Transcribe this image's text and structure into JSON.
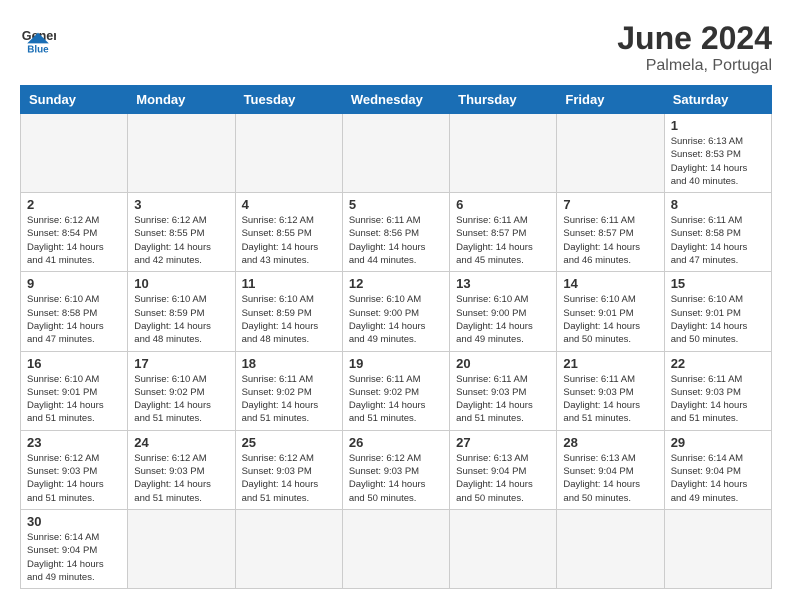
{
  "header": {
    "logo_general": "General",
    "logo_blue": "Blue",
    "month_year": "June 2024",
    "location": "Palmela, Portugal"
  },
  "days_of_week": [
    "Sunday",
    "Monday",
    "Tuesday",
    "Wednesday",
    "Thursday",
    "Friday",
    "Saturday"
  ],
  "weeks": [
    [
      {
        "day": "",
        "info": ""
      },
      {
        "day": "",
        "info": ""
      },
      {
        "day": "",
        "info": ""
      },
      {
        "day": "",
        "info": ""
      },
      {
        "day": "",
        "info": ""
      },
      {
        "day": "",
        "info": ""
      },
      {
        "day": "1",
        "info": "Sunrise: 6:13 AM\nSunset: 8:53 PM\nDaylight: 14 hours\nand 40 minutes."
      }
    ],
    [
      {
        "day": "2",
        "info": "Sunrise: 6:12 AM\nSunset: 8:54 PM\nDaylight: 14 hours\nand 41 minutes."
      },
      {
        "day": "3",
        "info": "Sunrise: 6:12 AM\nSunset: 8:55 PM\nDaylight: 14 hours\nand 42 minutes."
      },
      {
        "day": "4",
        "info": "Sunrise: 6:12 AM\nSunset: 8:55 PM\nDaylight: 14 hours\nand 43 minutes."
      },
      {
        "day": "5",
        "info": "Sunrise: 6:11 AM\nSunset: 8:56 PM\nDaylight: 14 hours\nand 44 minutes."
      },
      {
        "day": "6",
        "info": "Sunrise: 6:11 AM\nSunset: 8:57 PM\nDaylight: 14 hours\nand 45 minutes."
      },
      {
        "day": "7",
        "info": "Sunrise: 6:11 AM\nSunset: 8:57 PM\nDaylight: 14 hours\nand 46 minutes."
      },
      {
        "day": "8",
        "info": "Sunrise: 6:11 AM\nSunset: 8:58 PM\nDaylight: 14 hours\nand 47 minutes."
      }
    ],
    [
      {
        "day": "9",
        "info": "Sunrise: 6:10 AM\nSunset: 8:58 PM\nDaylight: 14 hours\nand 47 minutes."
      },
      {
        "day": "10",
        "info": "Sunrise: 6:10 AM\nSunset: 8:59 PM\nDaylight: 14 hours\nand 48 minutes."
      },
      {
        "day": "11",
        "info": "Sunrise: 6:10 AM\nSunset: 8:59 PM\nDaylight: 14 hours\nand 48 minutes."
      },
      {
        "day": "12",
        "info": "Sunrise: 6:10 AM\nSunset: 9:00 PM\nDaylight: 14 hours\nand 49 minutes."
      },
      {
        "day": "13",
        "info": "Sunrise: 6:10 AM\nSunset: 9:00 PM\nDaylight: 14 hours\nand 49 minutes."
      },
      {
        "day": "14",
        "info": "Sunrise: 6:10 AM\nSunset: 9:01 PM\nDaylight: 14 hours\nand 50 minutes."
      },
      {
        "day": "15",
        "info": "Sunrise: 6:10 AM\nSunset: 9:01 PM\nDaylight: 14 hours\nand 50 minutes."
      }
    ],
    [
      {
        "day": "16",
        "info": "Sunrise: 6:10 AM\nSunset: 9:01 PM\nDaylight: 14 hours\nand 51 minutes."
      },
      {
        "day": "17",
        "info": "Sunrise: 6:10 AM\nSunset: 9:02 PM\nDaylight: 14 hours\nand 51 minutes."
      },
      {
        "day": "18",
        "info": "Sunrise: 6:11 AM\nSunset: 9:02 PM\nDaylight: 14 hours\nand 51 minutes."
      },
      {
        "day": "19",
        "info": "Sunrise: 6:11 AM\nSunset: 9:02 PM\nDaylight: 14 hours\nand 51 minutes."
      },
      {
        "day": "20",
        "info": "Sunrise: 6:11 AM\nSunset: 9:03 PM\nDaylight: 14 hours\nand 51 minutes."
      },
      {
        "day": "21",
        "info": "Sunrise: 6:11 AM\nSunset: 9:03 PM\nDaylight: 14 hours\nand 51 minutes."
      },
      {
        "day": "22",
        "info": "Sunrise: 6:11 AM\nSunset: 9:03 PM\nDaylight: 14 hours\nand 51 minutes."
      }
    ],
    [
      {
        "day": "23",
        "info": "Sunrise: 6:12 AM\nSunset: 9:03 PM\nDaylight: 14 hours\nand 51 minutes."
      },
      {
        "day": "24",
        "info": "Sunrise: 6:12 AM\nSunset: 9:03 PM\nDaylight: 14 hours\nand 51 minutes."
      },
      {
        "day": "25",
        "info": "Sunrise: 6:12 AM\nSunset: 9:03 PM\nDaylight: 14 hours\nand 51 minutes."
      },
      {
        "day": "26",
        "info": "Sunrise: 6:12 AM\nSunset: 9:03 PM\nDaylight: 14 hours\nand 50 minutes."
      },
      {
        "day": "27",
        "info": "Sunrise: 6:13 AM\nSunset: 9:04 PM\nDaylight: 14 hours\nand 50 minutes."
      },
      {
        "day": "28",
        "info": "Sunrise: 6:13 AM\nSunset: 9:04 PM\nDaylight: 14 hours\nand 50 minutes."
      },
      {
        "day": "29",
        "info": "Sunrise: 6:14 AM\nSunset: 9:04 PM\nDaylight: 14 hours\nand 49 minutes."
      }
    ],
    [
      {
        "day": "30",
        "info": "Sunrise: 6:14 AM\nSunset: 9:04 PM\nDaylight: 14 hours\nand 49 minutes."
      },
      {
        "day": "",
        "info": ""
      },
      {
        "day": "",
        "info": ""
      },
      {
        "day": "",
        "info": ""
      },
      {
        "day": "",
        "info": ""
      },
      {
        "day": "",
        "info": ""
      },
      {
        "day": "",
        "info": ""
      }
    ]
  ]
}
